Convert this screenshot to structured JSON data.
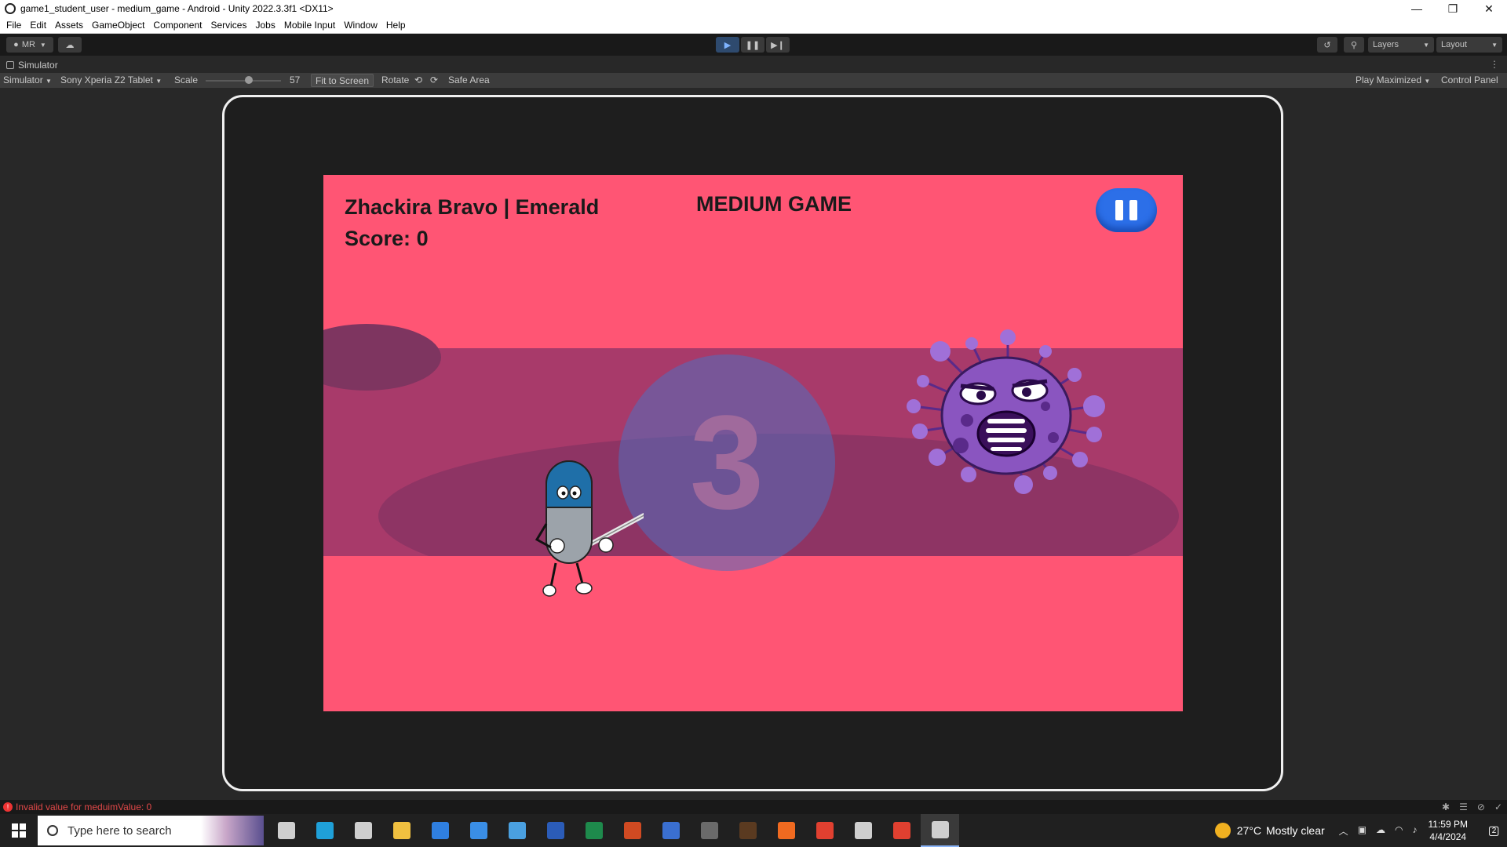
{
  "window": {
    "title": "game1_student_user - medium_game - Android - Unity 2022.3.3f1 <DX11>",
    "controls": [
      "—",
      "❐",
      "✕"
    ]
  },
  "menu": [
    "File",
    "Edit",
    "Assets",
    "GameObject",
    "Component",
    "Services",
    "Jobs",
    "Mobile Input",
    "Window",
    "Help"
  ],
  "toolbar": {
    "account_label": "MR",
    "layers_label": "Layers",
    "layout_label": "Layout"
  },
  "simulator_tab": {
    "title": "Simulator"
  },
  "simulator_bar": {
    "mode": "Simulator",
    "device": "Sony Xperia Z2 Tablet",
    "scale_label": "Scale",
    "scale_value": "57",
    "scale_fraction": 0.57,
    "fit_label": "Fit to Screen",
    "rotate_label": "Rotate",
    "safe_area_label": "Safe Area",
    "play_mode": "Play Maximized",
    "control_panel_label": "Control Panel"
  },
  "game": {
    "player_name": "Zhackira Bravo |  Emerald",
    "score_label": "Score:",
    "score_value": "0",
    "title": "MEDIUM GAME",
    "countdown": "3",
    "colors": {
      "background": "#ff5574",
      "band": "#a83a6a",
      "pause_button": "#2c6fe8",
      "virus": "#8a55c0"
    }
  },
  "status": {
    "error_text": "Invalid value for meduimValue: 0"
  },
  "taskbar": {
    "search_placeholder": "Type here to search",
    "apps": [
      {
        "name": "task-view-icon",
        "color": "#cfcfcf"
      },
      {
        "name": "edge-icon",
        "color": "#1fa0d8"
      },
      {
        "name": "settings-icon",
        "color": "#cfcfcf"
      },
      {
        "name": "file-explorer-icon",
        "color": "#f0c040"
      },
      {
        "name": "store-icon",
        "color": "#2f7fe0"
      },
      {
        "name": "mail-icon",
        "color": "#3a8ee6"
      },
      {
        "name": "app-blue-icon",
        "color": "#4aa0e0"
      },
      {
        "name": "word-icon",
        "color": "#2b5cb8"
      },
      {
        "name": "excel-icon",
        "color": "#1e8a4c"
      },
      {
        "name": "powerpoint-icon",
        "color": "#d04a22"
      },
      {
        "name": "app-stack-icon",
        "color": "#3a6fd0"
      },
      {
        "name": "calculator-icon",
        "color": "#6a6a6a"
      },
      {
        "name": "minecraft-icon",
        "color": "#5a3a20"
      },
      {
        "name": "xampp-icon",
        "color": "#f06a20"
      },
      {
        "name": "chrome-icon",
        "color": "#e04030"
      },
      {
        "name": "unity-hub-icon",
        "color": "#cfcfcf"
      },
      {
        "name": "chrome-profile-icon",
        "color": "#e04030"
      },
      {
        "name": "unity-editor-icon",
        "color": "#cfcfcf"
      }
    ],
    "temperature": "27°C",
    "weather": "Mostly clear",
    "time": "11:59 PM",
    "date": "4/4/2024",
    "notification_count": "2"
  }
}
